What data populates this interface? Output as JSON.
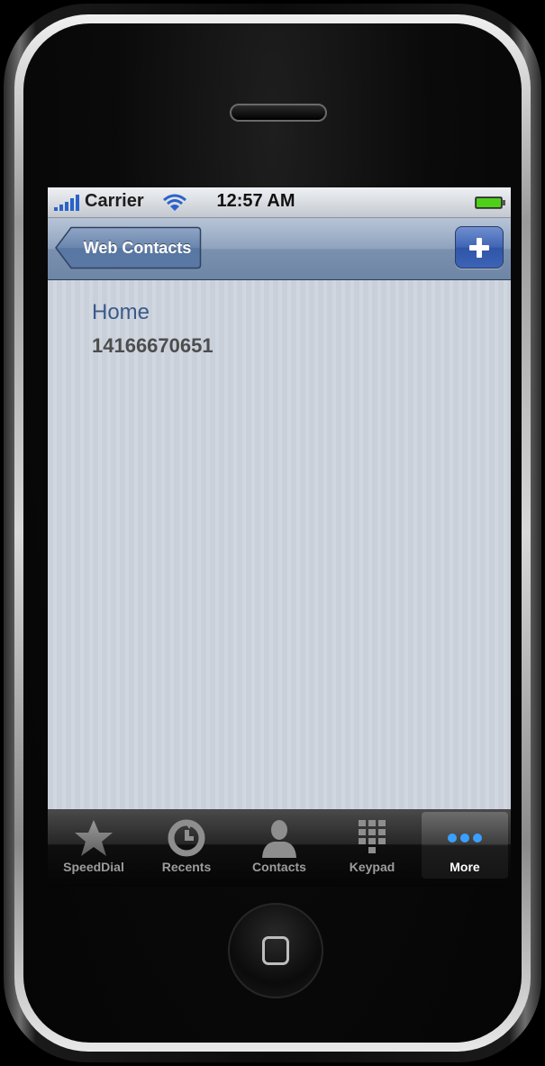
{
  "status_bar": {
    "carrier": "Carrier",
    "time": "12:57 AM"
  },
  "nav_bar": {
    "back_label": "Web Contacts",
    "add_icon": "plus-icon"
  },
  "contact": {
    "phone_label": "Home",
    "phone_number": "14166670651"
  },
  "tab_bar": {
    "tabs": [
      {
        "label": "SpeedDial",
        "icon": "star-icon"
      },
      {
        "label": "Recents",
        "icon": "recents-icon"
      },
      {
        "label": "Contacts",
        "icon": "person-icon"
      },
      {
        "label": "Keypad",
        "icon": "keypad-icon"
      },
      {
        "label": "More",
        "icon": "more-icon",
        "selected": true
      }
    ]
  },
  "colors": {
    "nav_bar": "#7a90ae",
    "add_button": "#3f64b4",
    "label_text": "#3b5a89",
    "number_text": "#4d4d4d",
    "more_dots": "#3aa0ff",
    "battery": "#4fd018"
  }
}
